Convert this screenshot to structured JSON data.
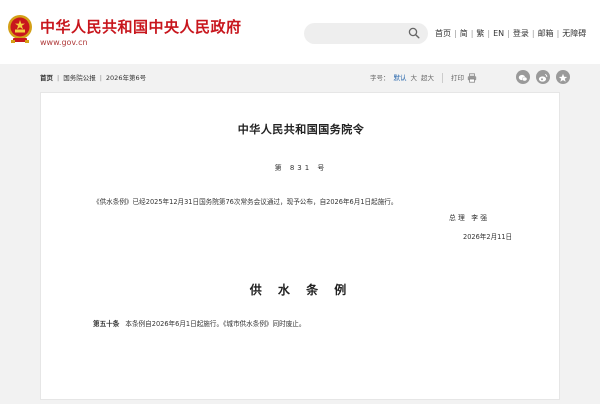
{
  "header": {
    "site_name": "中华人民共和国中央人民政府",
    "site_domain": "www.gov.cn",
    "search": {
      "value": "",
      "placeholder": ""
    },
    "nav": [
      "首页",
      "简",
      "繁",
      "EN",
      "登录",
      "邮箱",
      "无障碍"
    ]
  },
  "breadcrumb": [
    "首页",
    "国务院公报",
    "2026年第6号"
  ],
  "tools": {
    "font_size_label": "字号：",
    "font_sizes": [
      "默认",
      "大",
      "超大"
    ],
    "print_label": "打印"
  },
  "document": {
    "title": "中华人民共和国国务院令",
    "number": "第 831 号",
    "body": "《供水条例》已经2025年12月31日国务院第76次常务会议通过，现予公布，自2026年6月1日起施行。",
    "signatory": "总 理   李 强",
    "date": "2026年2月11日",
    "regulation_title": "供 水 条 例",
    "article_number": "第五十条",
    "article_text": "本条例自2026年6月1日起施行。《城市供水条例》同时废止。"
  },
  "colors": {
    "brand_red": "#c8161d",
    "link_blue": "#1d5fa8",
    "background": "#f2f2f2"
  },
  "icons": [
    "national-emblem-icon",
    "search-icon",
    "print-icon",
    "wechat-icon",
    "weibo-icon",
    "qzone-icon"
  ]
}
